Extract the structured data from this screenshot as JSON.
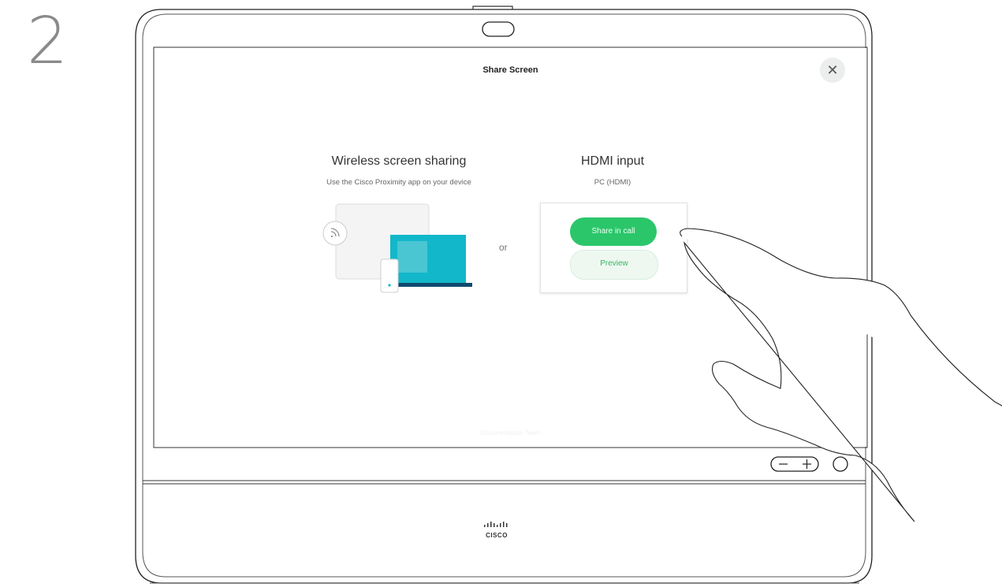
{
  "step_number": "2",
  "dialog": {
    "title": "Share Screen",
    "close_icon": "close-icon"
  },
  "wireless": {
    "heading": "Wireless screen sharing",
    "subheading": "Use the Cisco Proximity app on your device"
  },
  "separator": "or",
  "hdmi": {
    "heading": "HDMI input",
    "subheading": "PC (HDMI)",
    "share_label": "Share in call",
    "preview_label": "Preview"
  },
  "watermark": "Documentation Team",
  "device": {
    "brand_text": "CISCO",
    "volume_minus": "−",
    "volume_plus": "+"
  },
  "colors": {
    "share_green": "#2bc66a",
    "laptop_teal": "#12b7c9"
  }
}
